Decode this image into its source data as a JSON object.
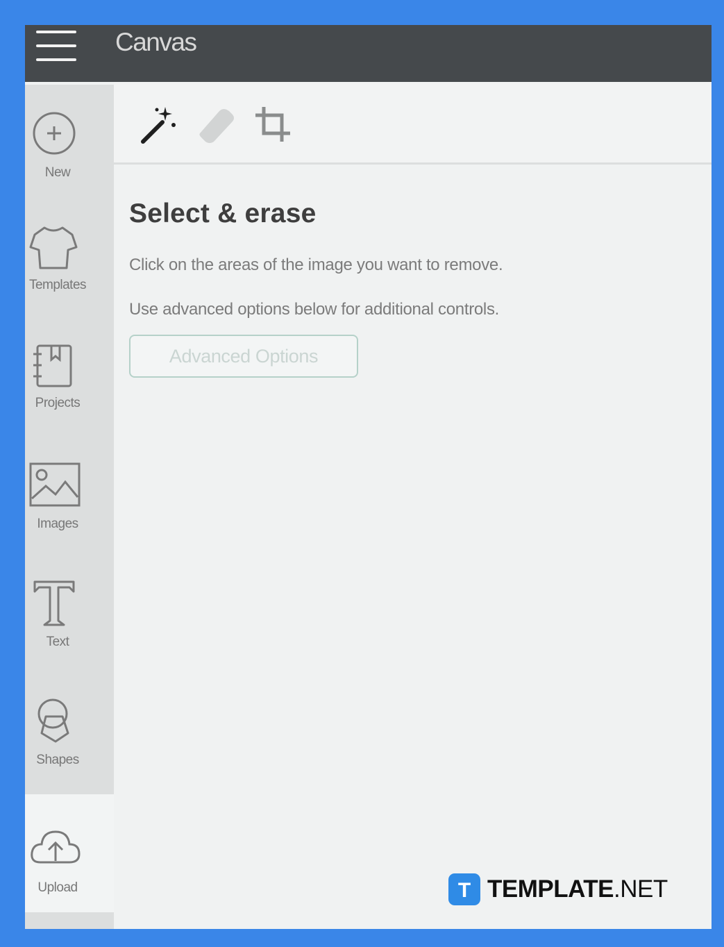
{
  "header": {
    "title": "Canvas",
    "menu_icon": "hamburger-menu-icon"
  },
  "sidebar": {
    "items": [
      {
        "label": "New",
        "icon": "plus-circle-icon"
      },
      {
        "label": "Templates",
        "icon": "tshirt-icon"
      },
      {
        "label": "Projects",
        "icon": "notebook-icon"
      },
      {
        "label": "Images",
        "icon": "image-icon"
      },
      {
        "label": "Text",
        "icon": "text-t-icon"
      },
      {
        "label": "Shapes",
        "icon": "shapes-icon"
      },
      {
        "label": "Upload",
        "icon": "cloud-upload-icon"
      }
    ]
  },
  "toolbar": {
    "tools": [
      {
        "icon": "magic-wand-icon",
        "state": "active"
      },
      {
        "icon": "eraser-icon",
        "state": "inactive"
      },
      {
        "icon": "crop-icon",
        "state": "inactive"
      }
    ]
  },
  "panel": {
    "title": "Select & erase",
    "instruction": "Click on the areas of the image you want to remove.",
    "hint": "Use advanced options below for additional controls.",
    "advanced_button": "Advanced Options"
  },
  "watermark": {
    "brand_bold": "TEMPLATE",
    "brand_suffix": ".NET",
    "logo_letter": "T"
  },
  "colors": {
    "frame": "#3a86e8",
    "topbar": "#45494c",
    "sidebar": "#dcdede",
    "panel_bg": "#f0f2f2",
    "accent_border": "#b5d1c9",
    "logo": "#2f8be6"
  }
}
